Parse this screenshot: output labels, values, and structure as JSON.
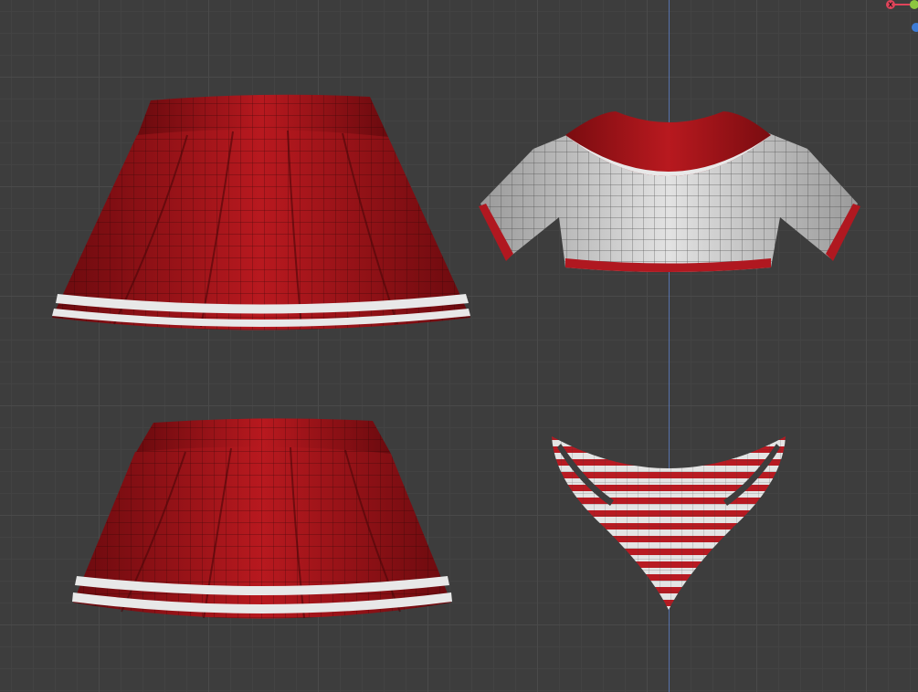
{
  "viewport": {
    "background_color": "#3d3d3d",
    "grid_major_color": "#4a4a4a",
    "grid_minor_color": "#434343",
    "axis_y_color": "#5a78b8"
  },
  "gizmo": {
    "x_label": "X",
    "x_color": "#e0445a",
    "y_color": "#8cc63f",
    "z_color": "#3d7bd6"
  },
  "objects": [
    {
      "name": "skirt-long",
      "color": "#a5161b",
      "trim": "#e8e8e8"
    },
    {
      "name": "crop-top",
      "color": "#d8d8d8",
      "trim": "#b01820"
    },
    {
      "name": "skirt-short",
      "color": "#a5161b",
      "trim": "#e8e8e8"
    },
    {
      "name": "bikini-bottom",
      "color": "#e4e4e4",
      "trim": "#b81a22"
    }
  ]
}
